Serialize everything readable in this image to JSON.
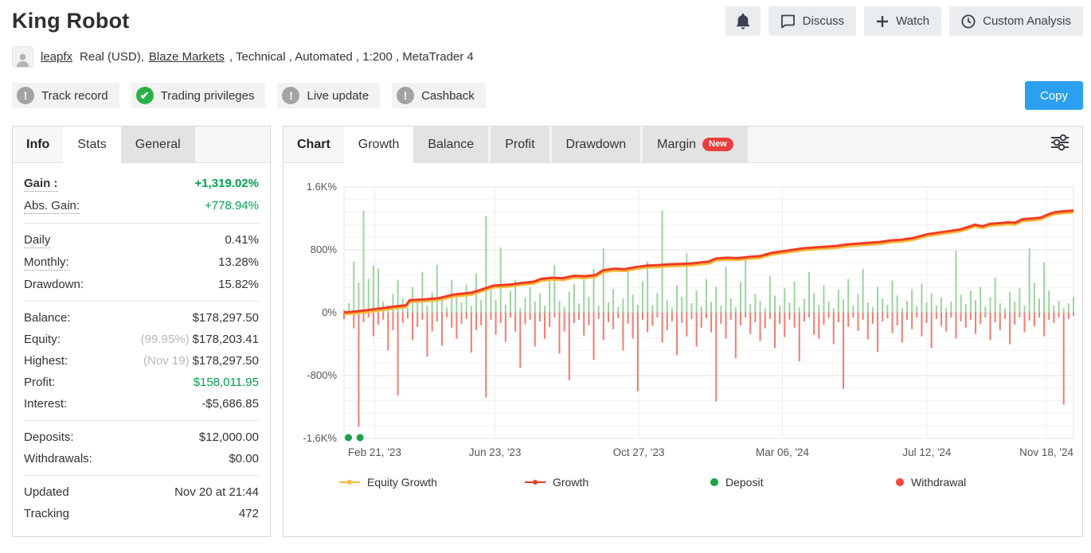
{
  "header": {
    "title": "King Robot",
    "buttons": [
      {
        "label": "Discuss",
        "icon": "chat-icon"
      },
      {
        "label": "Watch",
        "icon": "plus-icon"
      },
      {
        "label": "Custom Analysis",
        "icon": "clock-icon"
      }
    ],
    "bell_icon": "notification-bell"
  },
  "account": {
    "username": "leapfx",
    "seg1": "Real (USD),",
    "broker": "Blaze Markets",
    "seg2": ", Technical , Automated , 1:200 , MetaTrader 4"
  },
  "badges": [
    {
      "label": "Track record",
      "icon": "exclamation",
      "state": "unverified"
    },
    {
      "label": "Trading privileges",
      "icon": "check",
      "state": "verified"
    },
    {
      "label": "Live update",
      "icon": "exclamation",
      "state": "unverified"
    },
    {
      "label": "Cashback",
      "icon": "exclamation",
      "state": "unverified"
    }
  ],
  "copy_button": {
    "label": "Copy",
    "color": "#2b9ff0"
  },
  "info_panel": {
    "label": "Info",
    "tabs": [
      {
        "label": "Stats",
        "active": true
      },
      {
        "label": "General",
        "active": false
      }
    ],
    "groups": [
      {
        "rows": [
          {
            "label": "Gain :",
            "value": "+1,319.02%",
            "dotted": true,
            "bold": true,
            "green": true
          },
          {
            "label": "Abs. Gain:",
            "value": "+778.94%",
            "dotted": true,
            "green": true
          }
        ]
      },
      {
        "rows": [
          {
            "label": "Daily",
            "value": "0.41%",
            "dotted": true
          },
          {
            "label": "Monthly:",
            "value": "13.28%",
            "dotted": true
          },
          {
            "label": "Drawdown:",
            "value": "15.82%"
          }
        ]
      },
      {
        "rows": [
          {
            "label": "Balance:",
            "value": "$178,297.50"
          },
          {
            "label": "Equity:",
            "pre": "(99.95%)",
            "value": "$178,203.41"
          },
          {
            "label": "Highest:",
            "pre": "(Nov 19)",
            "value": "$178,297.50"
          },
          {
            "label": "Profit:",
            "value": "$158,011.95",
            "green": true
          },
          {
            "label": "Interest:",
            "value": "-$5,686.85"
          }
        ]
      },
      {
        "rows": [
          {
            "label": "Deposits:",
            "value": "$12,000.00"
          },
          {
            "label": "Withdrawals:",
            "value": "$0.00"
          }
        ]
      },
      {
        "rows": [
          {
            "label": "Updated",
            "value": "Nov 20 at 21:44"
          },
          {
            "label": "Tracking",
            "value": "472"
          }
        ]
      }
    ]
  },
  "chart_panel": {
    "label": "Chart",
    "tabs": [
      {
        "label": "Growth",
        "active": true
      },
      {
        "label": "Balance",
        "active": false
      },
      {
        "label": "Profit",
        "active": false
      },
      {
        "label": "Drawdown",
        "active": false
      },
      {
        "label": "Margin",
        "active": false,
        "badge": "New"
      }
    ],
    "filter_icon": "sliders-icon"
  },
  "chart_data": {
    "type": "line",
    "title": "Growth chart",
    "ylim": [
      -1600,
      1600
    ],
    "grid": true,
    "y_ticks": [
      {
        "label": "1.6K%",
        "v": 1600
      },
      {
        "label": "800%",
        "v": 800
      },
      {
        "label": "0%",
        "v": 0
      },
      {
        "label": "-800%",
        "v": -800
      },
      {
        "label": "-1.6K%",
        "v": -1600
      }
    ],
    "x_ticks": [
      {
        "label": "Feb 21, '23",
        "f": 0.042
      },
      {
        "label": "Jun 23, '23",
        "f": 0.207
      },
      {
        "label": "Oct 27, '23",
        "f": 0.404
      },
      {
        "label": "Mar 06, '24",
        "f": 0.601
      },
      {
        "label": "Jul 12, '24",
        "f": 0.799
      },
      {
        "label": "Nov 18, '24",
        "f": 0.963
      }
    ],
    "legend": [
      {
        "name": "Equity Growth",
        "type": "line",
        "color": "#f5b93c"
      },
      {
        "name": "Growth",
        "type": "line",
        "color": "#ee3c22"
      },
      {
        "name": "Deposit",
        "type": "dot",
        "color": "#1aa34a"
      },
      {
        "name": "Withdrawal",
        "type": "dot",
        "color": "#f4473a"
      }
    ],
    "colors": {
      "green_bar": "#9ed3a0",
      "red_bar": "#f57a6e",
      "growth_line": "#ee3c22",
      "equity_line": "#f5b93c",
      "deposit_dot": "#1aa34a"
    },
    "deposit_marker_fracs": [
      0.006,
      0.022
    ],
    "growth_line": [
      [
        0,
        5
      ],
      [
        0.01,
        10
      ],
      [
        0.03,
        30
      ],
      [
        0.05,
        55
      ],
      [
        0.07,
        80
      ],
      [
        0.085,
        95
      ],
      [
        0.09,
        160
      ],
      [
        0.11,
        170
      ],
      [
        0.13,
        185
      ],
      [
        0.15,
        230
      ],
      [
        0.16,
        240
      ],
      [
        0.175,
        255
      ],
      [
        0.19,
        300
      ],
      [
        0.205,
        345
      ],
      [
        0.215,
        350
      ],
      [
        0.23,
        360
      ],
      [
        0.245,
        380
      ],
      [
        0.26,
        395
      ],
      [
        0.27,
        430
      ],
      [
        0.285,
        445
      ],
      [
        0.3,
        440
      ],
      [
        0.315,
        470
      ],
      [
        0.33,
        465
      ],
      [
        0.345,
        480
      ],
      [
        0.355,
        540
      ],
      [
        0.37,
        560
      ],
      [
        0.385,
        555
      ],
      [
        0.4,
        580
      ],
      [
        0.415,
        600
      ],
      [
        0.43,
        605
      ],
      [
        0.445,
        615
      ],
      [
        0.46,
        620
      ],
      [
        0.475,
        625
      ],
      [
        0.49,
        640
      ],
      [
        0.5,
        650
      ],
      [
        0.51,
        690
      ],
      [
        0.525,
        700
      ],
      [
        0.54,
        695
      ],
      [
        0.555,
        710
      ],
      [
        0.57,
        720
      ],
      [
        0.585,
        760
      ],
      [
        0.6,
        780
      ],
      [
        0.615,
        800
      ],
      [
        0.63,
        820
      ],
      [
        0.645,
        830
      ],
      [
        0.66,
        840
      ],
      [
        0.675,
        850
      ],
      [
        0.69,
        870
      ],
      [
        0.705,
        880
      ],
      [
        0.72,
        890
      ],
      [
        0.735,
        900
      ],
      [
        0.75,
        920
      ],
      [
        0.765,
        930
      ],
      [
        0.78,
        950
      ],
      [
        0.8,
        1000
      ],
      [
        0.815,
        1020
      ],
      [
        0.83,
        1040
      ],
      [
        0.845,
        1060
      ],
      [
        0.855,
        1090
      ],
      [
        0.865,
        1120
      ],
      [
        0.875,
        1100
      ],
      [
        0.885,
        1130
      ],
      [
        0.9,
        1140
      ],
      [
        0.91,
        1150
      ],
      [
        0.92,
        1145
      ],
      [
        0.93,
        1190
      ],
      [
        0.945,
        1200
      ],
      [
        0.955,
        1210
      ],
      [
        0.965,
        1250
      ],
      [
        0.975,
        1280
      ],
      [
        0.985,
        1290
      ],
      [
        1,
        1300
      ]
    ],
    "green_bars": [
      40,
      120,
      650,
      380,
      1300,
      430,
      600,
      560,
      140,
      90,
      240,
      420,
      180,
      60,
      330,
      150,
      520,
      90,
      260,
      610,
      180,
      70,
      420,
      240,
      130,
      360,
      90,
      500,
      160,
      1230,
      330,
      160,
      830,
      100,
      280,
      420,
      60,
      190,
      330,
      140,
      250,
      90,
      430,
      610,
      150,
      80,
      270,
      360,
      120,
      440,
      200,
      560,
      90,
      820,
      130,
      300,
      70,
      180,
      540,
      230,
      100,
      400,
      650,
      90,
      250,
      1300,
      160,
      60,
      350,
      200,
      760,
      120,
      280,
      80,
      430,
      140,
      330,
      90,
      580,
      180,
      70,
      390,
      680,
      110,
      240,
      150,
      60,
      470,
      220,
      90,
      310,
      130,
      400,
      70,
      180,
      520,
      250,
      100,
      350,
      140,
      60,
      290,
      170,
      430,
      90,
      240,
      560,
      130,
      70,
      330,
      180,
      100,
      410,
      220,
      60,
      150,
      300,
      80,
      370,
      130,
      250,
      90,
      190,
      60,
      140,
      790,
      230,
      110,
      280,
      160,
      330,
      80,
      200,
      450,
      120,
      60,
      260,
      140,
      310,
      90,
      820,
      380,
      180,
      640,
      280,
      90,
      150,
      60,
      120,
      200
    ],
    "red_bars": [
      80,
      30,
      200,
      1450,
      120,
      60,
      300,
      150,
      90,
      480,
      220,
      1050,
      130,
      70,
      350,
      180,
      90,
      560,
      240,
      110,
      420,
      60,
      190,
      330,
      140,
      80,
      510,
      220,
      160,
      1080,
      90,
      280,
      130,
      370,
      60,
      240,
      700,
      150,
      90,
      430,
      110,
      330,
      180,
      60,
      520,
      240,
      860,
      130,
      90,
      290,
      160,
      600,
      80,
      350,
      120,
      210,
      70,
      480,
      140,
      330,
      1000,
      90,
      250,
      170,
      60,
      380,
      220,
      110,
      540,
      130,
      300,
      80,
      430,
      190,
      70,
      250,
      1130,
      140,
      330,
      90,
      580,
      160,
      60,
      270,
      120,
      360,
      200,
      80,
      450,
      140,
      310,
      90,
      190,
      620,
      110,
      60,
      280,
      330,
      150,
      70,
      400,
      120,
      970,
      180,
      60,
      230,
      90,
      340,
      140,
      500,
      110,
      70,
      260,
      160,
      380,
      90,
      210,
      60,
      300,
      130,
      450,
      80,
      170,
      240,
      60,
      330,
      110,
      190,
      90,
      270,
      140,
      60,
      350,
      120,
      220,
      80,
      400,
      150,
      60,
      250,
      100,
      170,
      60,
      300,
      90,
      130,
      60,
      1170,
      80,
      40
    ]
  }
}
